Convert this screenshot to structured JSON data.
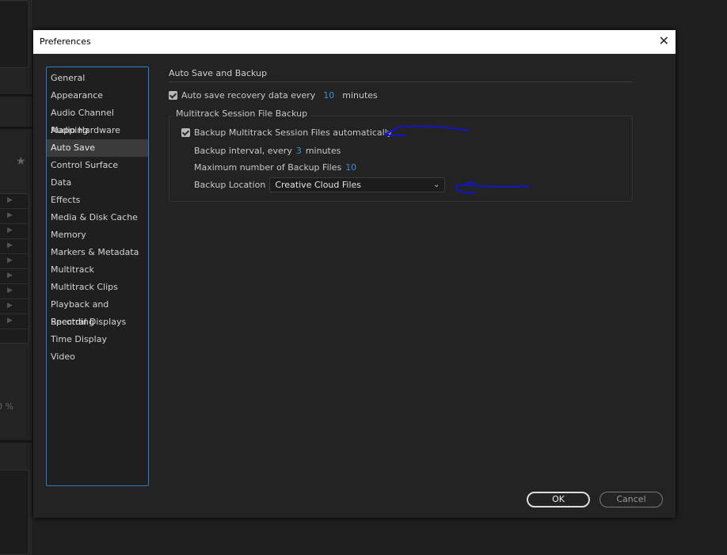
{
  "dialog": {
    "title": "Preferences",
    "close_icon": "close-icon"
  },
  "sidebar": {
    "items": [
      {
        "label": "General"
      },
      {
        "label": "Appearance"
      },
      {
        "label": "Audio Channel Mapping"
      },
      {
        "label": "Audio Hardware"
      },
      {
        "label": "Auto Save",
        "selected": true
      },
      {
        "label": "Control Surface"
      },
      {
        "label": "Data"
      },
      {
        "label": "Effects"
      },
      {
        "label": "Media & Disk Cache"
      },
      {
        "label": "Memory"
      },
      {
        "label": "Markers & Metadata"
      },
      {
        "label": "Multitrack"
      },
      {
        "label": "Multitrack Clips"
      },
      {
        "label": "Playback and Recording"
      },
      {
        "label": "Spectral Displays"
      },
      {
        "label": "Time Display"
      },
      {
        "label": "Video"
      }
    ]
  },
  "main": {
    "section_title": "Auto Save and Backup",
    "autosave": {
      "checked": true,
      "label": "Auto save recovery data every",
      "value": "10",
      "unit": "minutes"
    },
    "group": {
      "title": "Multitrack Session File Backup",
      "backup_auto": {
        "checked": true,
        "label": "Backup Multitrack Session Files automatically"
      },
      "interval": {
        "label": "Backup interval, every",
        "value": "3",
        "unit": "minutes"
      },
      "max_files": {
        "label": "Maximum number of Backup Files",
        "value": "10"
      },
      "location": {
        "label": "Backup Location",
        "value": "Creative Cloud Files"
      }
    }
  },
  "buttons": {
    "ok": "OK",
    "cancel": "Cancel"
  },
  "background": {
    "percent_text": "0 %"
  },
  "colors": {
    "accent": "#3e8ed6",
    "annotation": "#1010c0",
    "selection_border": "#2f7bc4"
  }
}
